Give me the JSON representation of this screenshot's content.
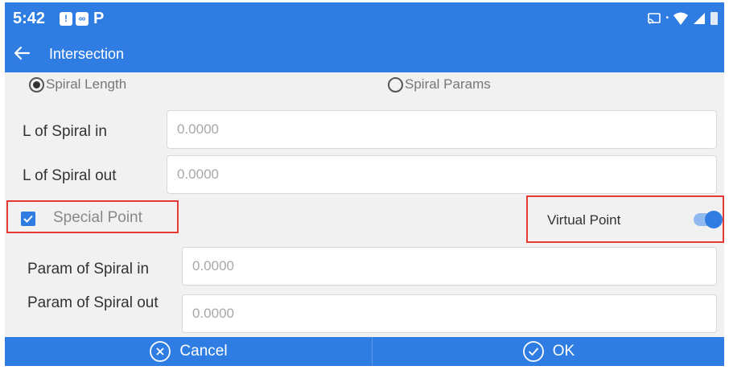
{
  "status_bar": {
    "time": "5:42",
    "icon1": "!",
    "icon2": "∞",
    "icon3": "P"
  },
  "app_bar": {
    "title": "Intersection"
  },
  "radio_options": {
    "spiral_length": "Spiral Length",
    "spiral_params": "Spiral Params",
    "selected": "spiral_length"
  },
  "fields": {
    "l_spiral_in": {
      "label": "L of Spiral in",
      "placeholder": "0.0000"
    },
    "l_spiral_out": {
      "label": "L of Spiral out",
      "placeholder": "0.0000"
    },
    "param_spiral_in": {
      "label": "Param of Spiral in",
      "placeholder": "0.0000"
    },
    "param_spiral_out": {
      "label": "Param of Spiral out",
      "placeholder": "0.0000"
    }
  },
  "special_point": {
    "label": "Special Point",
    "checked": true
  },
  "virtual_point": {
    "label": "Virtual Point",
    "enabled": true
  },
  "bottom_bar": {
    "cancel_label": "Cancel",
    "ok_label": "OK"
  },
  "colors": {
    "primary": "#2f7de3",
    "highlight": "#e53935",
    "background": "#f1f1f1"
  },
  "icons": [
    "back-arrow-icon",
    "cast-icon",
    "wifi-icon",
    "signal-icon",
    "battery-icon",
    "cancel-circle-icon",
    "check-circle-icon",
    "checkbox-checked-icon"
  ]
}
